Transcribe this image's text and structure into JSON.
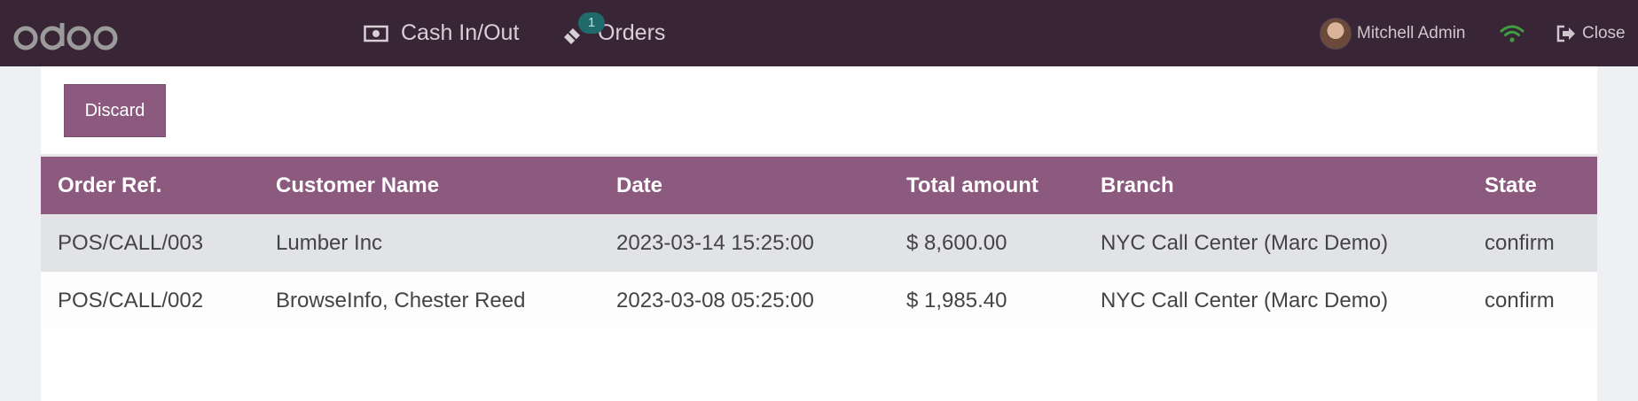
{
  "navbar": {
    "logo_text": "odoo",
    "cash_label": "Cash In/Out",
    "cash_icon": "money-icon",
    "orders_label": "Orders",
    "orders_icon": "ticket-icon",
    "orders_badge": "1",
    "user_name": "Mitchell Admin",
    "wifi_icon": "wifi-icon",
    "wifi_color": "#3f9f3f",
    "close_label": "Close",
    "close_icon": "sign-out-icon",
    "bar_color": "#382536"
  },
  "toolbar": {
    "discard_label": "Discard",
    "accent_color": "#8b5a7e"
  },
  "table": {
    "headers": [
      "Order Ref.",
      "Customer Name",
      "Date",
      "Total amount",
      "Branch",
      "State"
    ],
    "rows": [
      [
        "POS/CALL/003",
        "Lumber Inc",
        "2023-03-14 15:25:00",
        "$ 8,600.00",
        "NYC Call Center (Marc Demo)",
        "confirm"
      ],
      [
        "POS/CALL/002",
        "BrowseInfo, Chester Reed",
        "2023-03-08 05:25:00",
        "$ 1,985.40",
        "NYC Call Center (Marc Demo)",
        "confirm"
      ]
    ]
  }
}
